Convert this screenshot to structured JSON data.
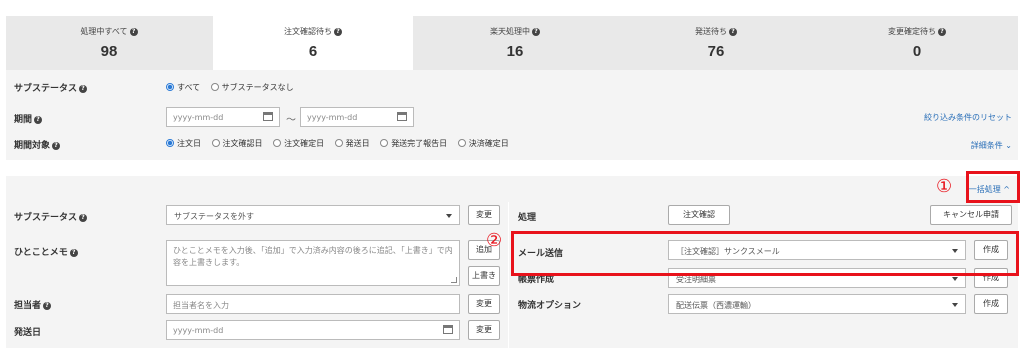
{
  "status_tabs": [
    {
      "label": "処理中すべて",
      "count": "98"
    },
    {
      "label": "注文確認待ち",
      "count": "6"
    },
    {
      "label": "楽天処理中",
      "count": "16"
    },
    {
      "label": "発送待ち",
      "count": "76"
    },
    {
      "label": "変更確定待ち",
      "count": "0"
    }
  ],
  "help_glyph": "?",
  "filter": {
    "substatus": {
      "label": "サブステータス",
      "options": [
        "すべて",
        "サブステータスなし"
      ],
      "selected": "すべて"
    },
    "period": {
      "label": "期間",
      "from_placeholder": "yyyy-mm-dd",
      "separator": "〜",
      "to_placeholder": "yyyy-mm-dd"
    },
    "period_target": {
      "label": "期間対象",
      "options": [
        "注文日",
        "注文確認日",
        "注文確定日",
        "発送日",
        "発送完了報告日",
        "決済確定日"
      ],
      "selected": "注文日"
    },
    "reset_link": "絞り込み条件のリセット",
    "detail_link": "詳細条件 ⌄"
  },
  "bulk": {
    "toggle_label": "一括処理 ^",
    "left": {
      "substatus": {
        "label": "サブステータス",
        "select_value": "サブステータスを外す",
        "button": "変更"
      },
      "memo": {
        "label": "ひとことメモ",
        "placeholder": "ひとことメモを入力後、「追加」で入力済み内容の後ろに追記、「上書き」で内容を上書きします。",
        "add_button": "追加",
        "overwrite_button": "上書き"
      },
      "assignee": {
        "label": "担当者",
        "placeholder": "担当者名を入力",
        "button": "変更"
      },
      "ship_date": {
        "label": "発送日",
        "placeholder": "yyyy-mm-dd",
        "button": "変更"
      }
    },
    "right": {
      "process": {
        "label": "処理",
        "confirm_button": "注文確認",
        "cancel_button": "キャンセル申請"
      },
      "mail": {
        "label": "メール送信",
        "select_value": "［注文確認］サンクスメール",
        "button": "作成"
      },
      "doc": {
        "label": "帳票作成",
        "select_value": "受注明細票",
        "button": "作成"
      },
      "logistics": {
        "label": "物流オプション",
        "select_value": "配送伝票（西濃運輸）",
        "button": "作成"
      }
    }
  },
  "annotations": {
    "marker1": "①",
    "marker2": "②",
    "color": "#e8121b"
  }
}
